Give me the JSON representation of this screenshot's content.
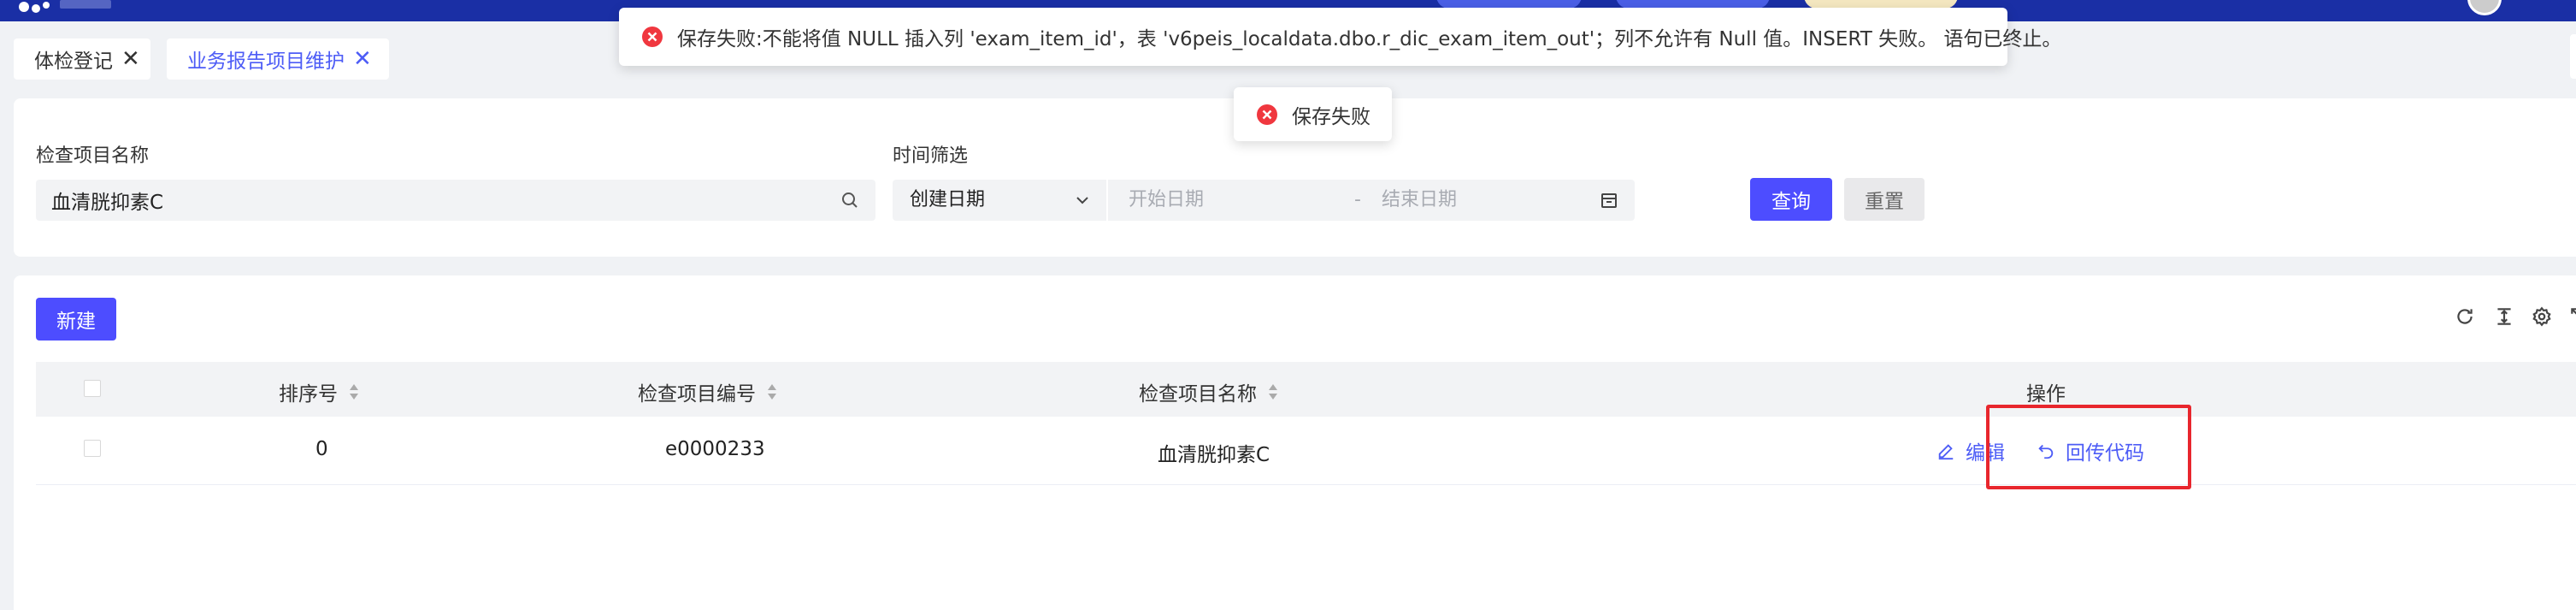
{
  "tabs": [
    {
      "label": "体检登记",
      "close": "✕"
    },
    {
      "label": "业务报告项目维护",
      "close": "✕"
    }
  ],
  "filter": {
    "item_name_label": "检查项目名称",
    "item_name_value": "血清胱抑素C",
    "time_label": "时间筛选",
    "date_type_value": "创建日期",
    "start_placeholder": "开始日期",
    "range_separator": "-",
    "end_placeholder": "结束日期",
    "query_label": "查询",
    "reset_label": "重置"
  },
  "table": {
    "new_label": "新建",
    "columns": [
      "排序号",
      "检查项目编号",
      "检查项目名称",
      "操作"
    ],
    "rows": [
      {
        "order": "0",
        "code": "e0000233",
        "name": "血清胱抑素C"
      }
    ],
    "actions": {
      "edit": "编辑",
      "upload": "回传代码"
    }
  },
  "toasts": {
    "main": "保存失败:不能将值 NULL 插入列 'exam_item_id'，表 'v6peis_localdata.dbo.r_dic_exam_item_out'；列不允许有 Null 值。INSERT 失败。 语句已终止。",
    "sub": "保存失败"
  },
  "colors": {
    "primary": "#4d4dff",
    "link": "#4d5cf6",
    "header": "#1a2fa5",
    "error": "#f0373f",
    "highlight": "#e8262d"
  },
  "icons": [
    "search-icon",
    "chevron-down-icon",
    "calendar-icon",
    "refresh-icon",
    "density-icon",
    "gear-icon",
    "expand-icon",
    "sort-icon",
    "edit-icon",
    "undo-icon",
    "error-icon",
    "close-icon"
  ]
}
